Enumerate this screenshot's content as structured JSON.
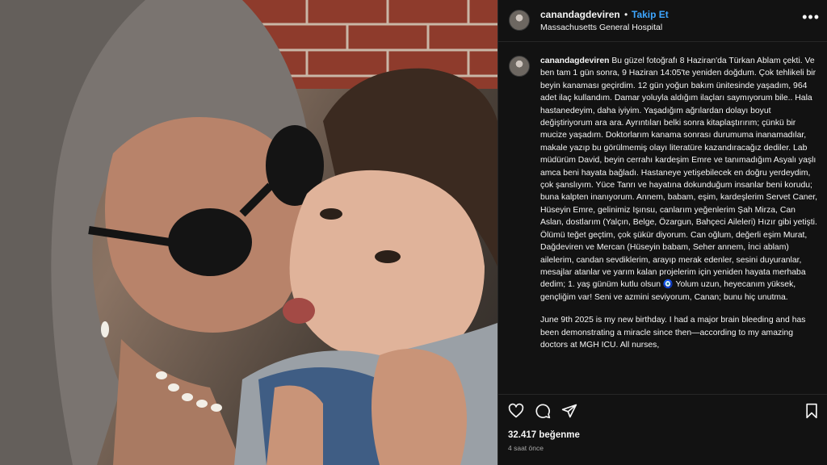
{
  "post": {
    "username": "canandagdeviren",
    "separator": "•",
    "follow_label": "Takip Et",
    "location": "Massachusetts General Hospital",
    "more_icon": "more-horizontal-icon",
    "caption_tr": "Bu güzel fotoğrafı 8 Haziran'da Türkan Ablam çekti. Ve ben tam 1 gün sonra, 9 Haziran 14:05'te yeniden doğdum. Çok tehlikeli bir beyin kanaması geçirdim. 12 gün yoğun bakım ünitesinde yaşadım, 964 adet ilaç kullandım. Damar yoluyla aldığım ilaçları saymıyorum bile.. Hala hastanedeyim, daha iyiyim. Yaşadığım ağrılardan dolayı boyut değiştiriyorum ara ara. Ayrıntıları belki sonra kitaplaştırırım; çünkü bir mucize yaşadım. Doktorlarım kanama sonrası durumuma inanamadılar, makale yazıp bu görülmemiş olayı literatüre kazandıracağız dediler. Lab müdürüm David, beyin cerrahı kardeşim Emre ve tanımadığım Asyalı yaşlı amca beni hayata bağladı. Hastaneye yetişebilecek en doğru yerdeydim, çok şanslıyım. Yüce Tanrı ve hayatına dokunduğum insanlar beni korudu; buna kalpten inanıyorum. Annem, babam, eşim, kardeşlerim Servet Caner, Hüseyin Emre, gelinimiz Işınsu, canlarım yeğenlerim Şah Mirza, Can Aslan, dostlarım (Yalçın, Belge, Özargun, Bahçeci Aileleri) Hızır gibi yetişti. Ölümü teğet geçtim, çok şükür diyorum. Can oğlum, değerli eşim Murat, Dağdeviren ve Mercan (Hüseyin babam, Seher annem, İnci ablam) ailelerim, candan sevdiklerim, arayıp merak edenler, sesini duyuranlar, mesajlar atanlar ve yarım kalan projelerim için yeniden hayata merhaba dedim; 1. yaş günüm kutlu olsun 🧿 Yolum uzun, heyecanım yüksek, gençliğim var! Seni ve azmini seviyorum, Canan; bunu hiç unutma.",
    "caption_en": "June 9th 2025 is my new birthday. I had a major brain bleeding and has been demonstrating a miracle since then—according to my amazing doctors at MGH ICU. All nurses,",
    "likes": "32.417 beğenme",
    "time_ago": "4 saat önce",
    "icons": [
      "heart-icon",
      "comment-icon",
      "share-icon",
      "bookmark-icon"
    ],
    "accent_color": "#3ea6ff"
  }
}
